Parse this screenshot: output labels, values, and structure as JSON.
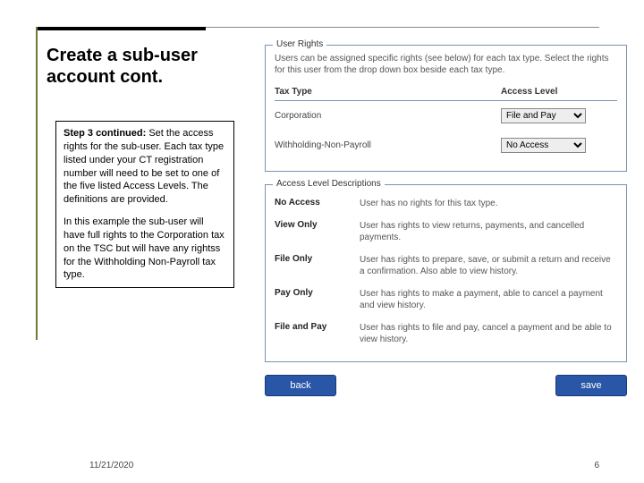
{
  "slide": {
    "title": "Create a sub-user account cont.",
    "date": "11/21/2020",
    "page": "6"
  },
  "left": {
    "p1_lead": "Step 3 continued:",
    "p1_rest": " Set the access rights for the sub-user. Each tax type listed under your CT registration number will need to be set to one of the five listed Access Levels. The definitions are provided.",
    "p2": "In this example the sub-user will have full rights to the Corporation tax on the TSC but will have any rightss for the Withholding Non-Payroll tax type."
  },
  "app": {
    "rights": {
      "legend": "User Rights",
      "intro": "Users can be assigned specific rights (see below) for each tax type. Select the rights for this user from the drop down box beside each tax type.",
      "head_taxtype": "Tax Type",
      "head_access": "Access Level",
      "rows": [
        {
          "name": "Corporation",
          "value": "File and Pay"
        },
        {
          "name": "Withholding-Non-Payroll",
          "value": "No Access"
        }
      ]
    },
    "desc": {
      "legend": "Access Level Descriptions",
      "items": [
        {
          "label": "No Access",
          "text": "User has no rights for this tax type."
        },
        {
          "label": "View Only",
          "text": "User has rights to view returns, payments, and cancelled payments."
        },
        {
          "label": "File Only",
          "text": "User has rights to prepare, save, or submit a return and receive a confirmation. Also able to view history."
        },
        {
          "label": "Pay Only",
          "text": "User has rights to make a payment, able to cancel a payment and view history."
        },
        {
          "label": "File and Pay",
          "text": "User has rights to file and pay, cancel a payment and be able to view history."
        }
      ]
    },
    "buttons": {
      "back": "back",
      "save": "save"
    },
    "options": [
      "No Access",
      "View Only",
      "File Only",
      "Pay Only",
      "File and Pay"
    ]
  }
}
